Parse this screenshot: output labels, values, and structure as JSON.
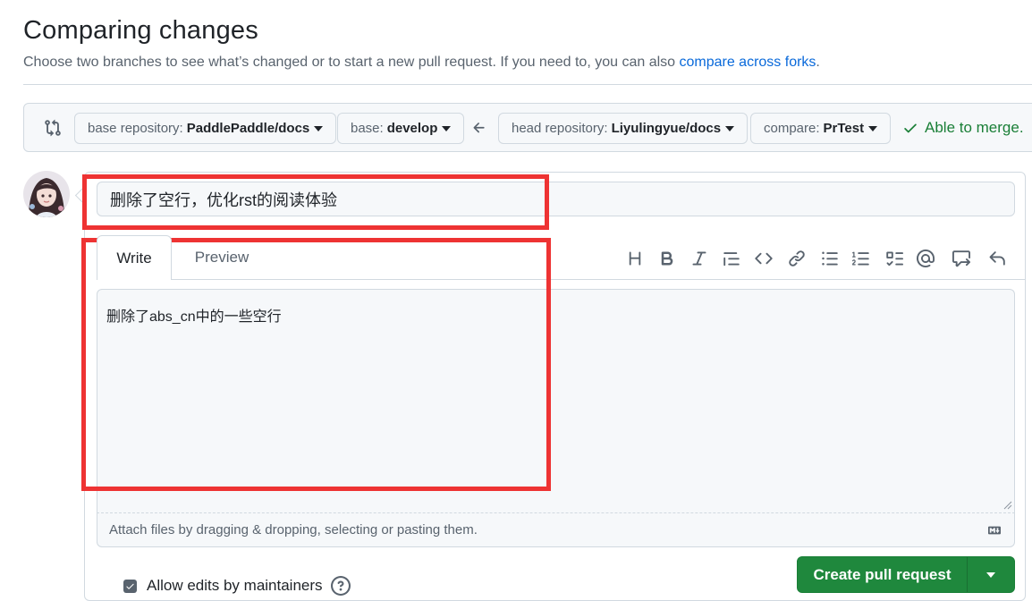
{
  "page": {
    "title": "Comparing changes",
    "subtitle_prefix": "Choose two branches to see what’s changed or to start a new pull request. If you need to, you can also ",
    "subtitle_link": "compare across forks",
    "subtitle_suffix": "."
  },
  "range": {
    "base_repo_label": "base repository:",
    "base_repo_value": "PaddlePaddle/docs",
    "base_label": "base:",
    "base_value": "develop",
    "head_repo_label": "head repository:",
    "head_repo_value": "Liyulingyue/docs",
    "compare_label": "compare:",
    "compare_value": "PrTest",
    "merge_status": "Able to merge."
  },
  "pr": {
    "title_value": "删除了空行，优化rst的阅读体验",
    "tabs": {
      "write": "Write",
      "preview": "Preview"
    },
    "body_value": "删除了abs_cn中的一些空行",
    "attach_hint": "Attach files by dragging & dropping, selecting or pasting them.",
    "toolbar_icons": [
      "heading-icon",
      "bold-icon",
      "italic-icon",
      "quote-icon",
      "code-icon",
      "link-icon",
      "unordered-list-icon",
      "ordered-list-icon",
      "task-list-icon",
      "mention-icon",
      "reference-icon",
      "undo-icon"
    ]
  },
  "footer": {
    "allow_edits_label": "Allow edits by maintainers",
    "allow_edits_checked": true,
    "create_button_label": "Create pull request"
  },
  "colors": {
    "accent_link": "#0969da",
    "merge_green": "#1a7f37",
    "primary_button": "#1f883d",
    "highlight_red": "#ee3333"
  }
}
